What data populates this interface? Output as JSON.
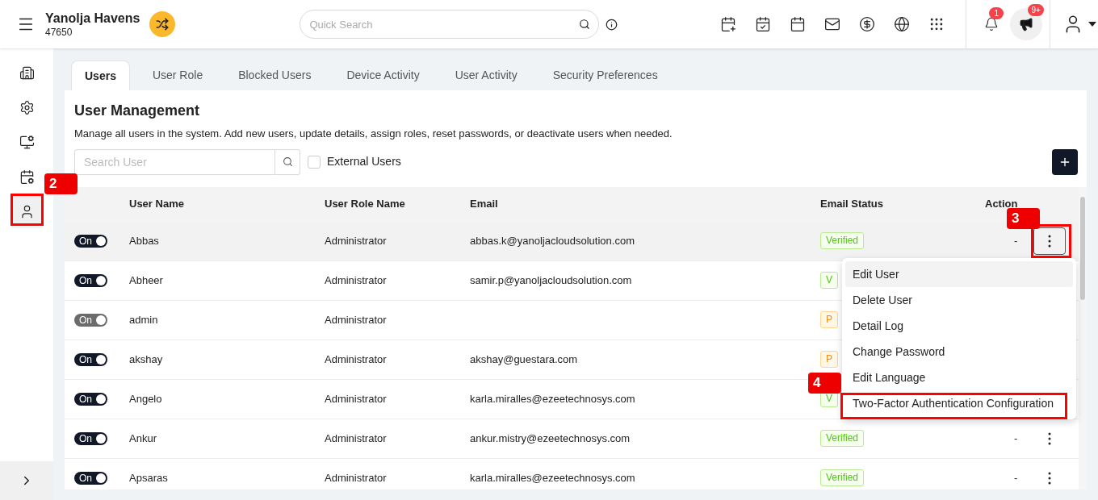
{
  "header": {
    "property_name": "Yanolja Havens",
    "property_code": "47650",
    "search": {
      "placeholder": "Quick Search"
    },
    "notification_count": "1",
    "announcement_count": "9+"
  },
  "sidebar": {
    "items": [
      {
        "selected": false
      },
      {
        "selected": false
      },
      {
        "selected": false
      },
      {
        "selected": false
      },
      {
        "selected": true
      }
    ]
  },
  "tabs": [
    {
      "label": "Users",
      "selected": true
    },
    {
      "label": "User Role",
      "selected": false
    },
    {
      "label": "Blocked Users",
      "selected": false
    },
    {
      "label": "Device Activity",
      "selected": false
    },
    {
      "label": "User Activity",
      "selected": false
    },
    {
      "label": "Security Preferences",
      "selected": false
    }
  ],
  "page": {
    "title": "User Management",
    "description": "Manage all users in the system. Add new users, update details, assign roles, reset passwords, or deactivate users when needed.",
    "search": {
      "placeholder": "Search User"
    },
    "external_users": {
      "label": "External Users",
      "checked": false
    }
  },
  "table": {
    "columns": [
      "User Name",
      "User Role Name",
      "Email",
      "Email Status",
      "Action"
    ],
    "rows": [
      {
        "toggle": "On",
        "disabled": false,
        "selected": true,
        "name": "Abbas",
        "role": "Administrator",
        "email": "abbas.k@yanoljacloudsolution.com",
        "status": {
          "text": "Verified",
          "kind": "verified"
        },
        "action": "-"
      },
      {
        "toggle": "On",
        "disabled": false,
        "selected": false,
        "name": "Abheer",
        "role": "Administrator",
        "email": "samir.p@yanoljacloudsolution.com",
        "status": {
          "text": "V",
          "kind": "verified"
        }
      },
      {
        "toggle": "On",
        "disabled": true,
        "selected": false,
        "name": "admin",
        "role": "Administrator",
        "status": {
          "text": "P",
          "kind": "pending"
        }
      },
      {
        "toggle": "On",
        "disabled": false,
        "selected": false,
        "name": "akshay",
        "role": "Administrator",
        "email": "akshay@guestara.com",
        "status": {
          "text": "P",
          "kind": "pending"
        }
      },
      {
        "toggle": "On",
        "disabled": false,
        "selected": false,
        "name": "Angelo",
        "role": "Administrator",
        "email": "karla.miralles@ezeetechnosys.com",
        "status": {
          "text": "V",
          "kind": "verified"
        }
      },
      {
        "toggle": "On",
        "disabled": false,
        "selected": false,
        "name": "Ankur",
        "role": "Administrator",
        "email": "ankur.mistry@ezeetechnosys.com",
        "status": {
          "text": "Verified",
          "kind": "verified"
        },
        "action": "-"
      },
      {
        "toggle": "On",
        "disabled": false,
        "selected": false,
        "name": "Apsaras",
        "role": "Administrator",
        "email": "karla.miralles@ezeetechnosys.com",
        "status": {
          "text": "Verified",
          "kind": "verified"
        },
        "action": "-"
      }
    ]
  },
  "action_menu": {
    "items": [
      {
        "label": "Edit User",
        "highlighted": true
      },
      {
        "label": "Delete User",
        "highlighted": false
      },
      {
        "label": "Detail Log",
        "highlighted": false
      },
      {
        "label": "Change Password",
        "highlighted": false
      },
      {
        "label": "Edit Language",
        "highlighted": false
      },
      {
        "label": "Two-Factor Authentication Configuration",
        "highlighted": false
      }
    ]
  },
  "annotations": [
    {
      "label": "2"
    },
    {
      "label": "3"
    },
    {
      "label": "4"
    }
  ]
}
